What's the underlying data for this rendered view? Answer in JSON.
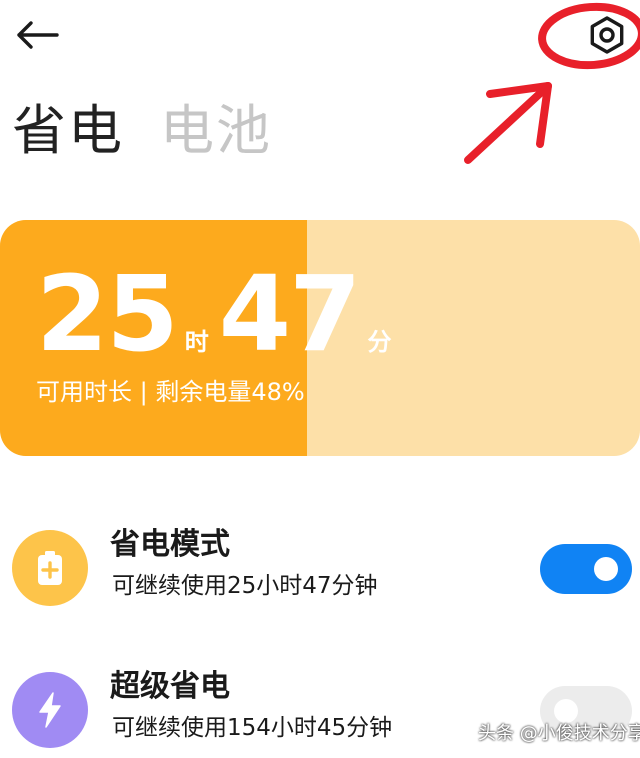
{
  "header": {
    "back_icon": "arrow-left-icon",
    "settings_icon": "hex-gear-icon",
    "annotation_color": "#e8202a"
  },
  "tabs": [
    {
      "label": "省电",
      "active": true
    },
    {
      "label": "电池",
      "active": false
    }
  ],
  "battery": {
    "hours": "25",
    "hours_unit": "时",
    "minutes": "47",
    "minutes_unit": "分",
    "subtitle": "可用时长 | 剩余电量48%",
    "level_percent": 48,
    "fill_color": "#fdaa1d",
    "track_color": "#fde0a8"
  },
  "modes": [
    {
      "title": "省电模式",
      "subtitle": "可继续使用25小时47分钟",
      "icon": "battery-plus-icon",
      "icon_color": "#fdc44a",
      "enabled": true
    },
    {
      "title": "超级省电",
      "subtitle": "可继续使用154小时45分钟",
      "icon": "lightning-icon",
      "icon_color": "#a08bf3",
      "enabled": false
    }
  ],
  "watermark": "头条 @小俊技术分享"
}
